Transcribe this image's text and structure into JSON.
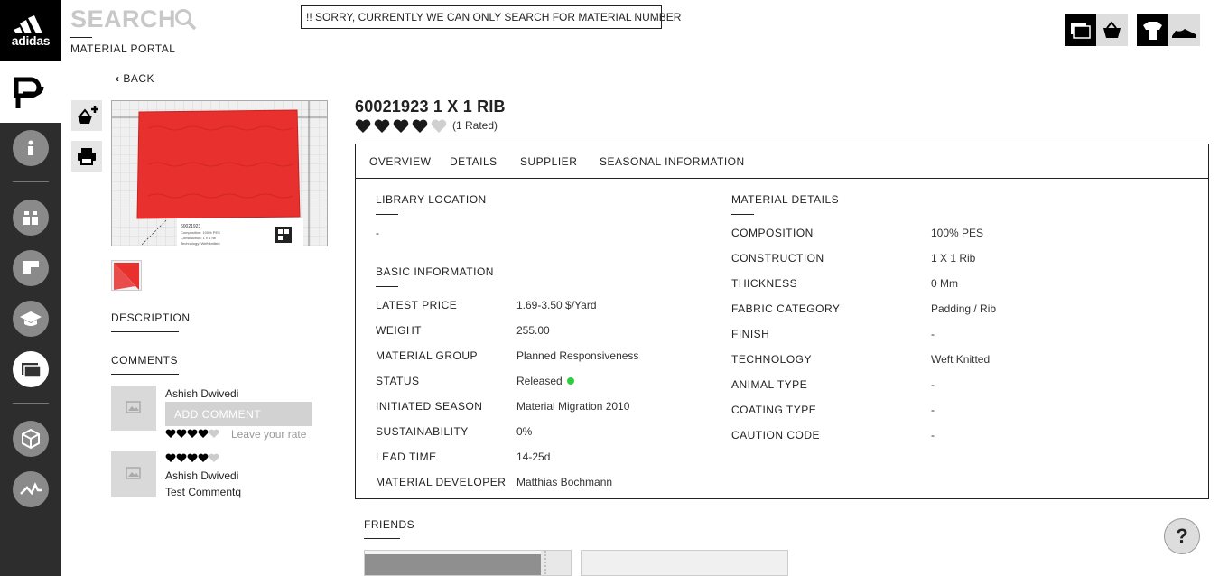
{
  "brand": {
    "logo_text": "adidas"
  },
  "header": {
    "search_label": "SEARCH",
    "subtitle": "MATERIAL PORTAL",
    "notice": "!! SORRY, CURRENTLY WE CAN ONLY SEARCH FOR MATERIAL NUMBER"
  },
  "nav": {
    "back_label": "BACK"
  },
  "material": {
    "title": "60021923 1 X 1 RIB",
    "rating_filled": 4,
    "rating_max": 5,
    "rating_text": "(1 Rated)",
    "swatch_color": "#e8302e"
  },
  "sections": {
    "description": "DESCRIPTION",
    "comments": "COMMENTS",
    "friends": "FRIENDS"
  },
  "comments": {
    "input_placeholder": "ADD COMMENT",
    "rate_prompt": "Leave your rate",
    "current_user": "Ashish Dwivedi",
    "items": [
      {
        "author": "Ashish Dwivedi",
        "text": "Test Commentq",
        "rating": 4
      }
    ]
  },
  "tabs": [
    "OVERVIEW",
    "DETAILS",
    "SUPPLIER",
    "SEASONAL INFORMATION"
  ],
  "overview": {
    "library_location": {
      "heading": "LIBRARY LOCATION",
      "value": "-"
    },
    "basic_information": {
      "heading": "BASIC INFORMATION",
      "rows": [
        {
          "label": "LATEST PRICE",
          "value": "1.69-3.50 $/Yard"
        },
        {
          "label": "WEIGHT",
          "value": "255.00"
        },
        {
          "label": "MATERIAL GROUP",
          "value": "Planned Responsiveness"
        },
        {
          "label": "STATUS",
          "value": "Released"
        },
        {
          "label": "INITIATED SEASON",
          "value": "Material Migration 2010"
        },
        {
          "label": "SUSTAINABILITY",
          "value": "0%"
        },
        {
          "label": "LEAD TIME",
          "value": "14-25d"
        },
        {
          "label": "MATERIAL DEVELOPER",
          "value": "Matthias Bochmann"
        }
      ]
    },
    "material_details": {
      "heading": "MATERIAL DETAILS",
      "rows": [
        {
          "label": "COMPOSITION",
          "value": "100% PES"
        },
        {
          "label": "CONSTRUCTION",
          "value": "1 X 1 Rib"
        },
        {
          "label": "THICKNESS",
          "value": "0 Mm"
        },
        {
          "label": "FABRIC CATEGORY",
          "value": "Padding / Rib"
        },
        {
          "label": "FINISH",
          "value": "-"
        },
        {
          "label": "TECHNOLOGY",
          "value": "Weft Knitted"
        },
        {
          "label": "ANIMAL TYPE",
          "value": "-"
        },
        {
          "label": "COATING TYPE",
          "value": "-"
        },
        {
          "label": "CAUTION CODE",
          "value": "-"
        }
      ]
    }
  },
  "swatch_label": {
    "number": "60021923",
    "composition": "Composition: 100% PES",
    "construction": "Construction: 1 x 1 rib",
    "technology": "Technology: Weft knitted"
  },
  "help": {
    "label": "?"
  },
  "colors": {
    "sidebar": "#2d2d2d",
    "status_released": "#2ecc40",
    "swatch": "#e8302e"
  }
}
